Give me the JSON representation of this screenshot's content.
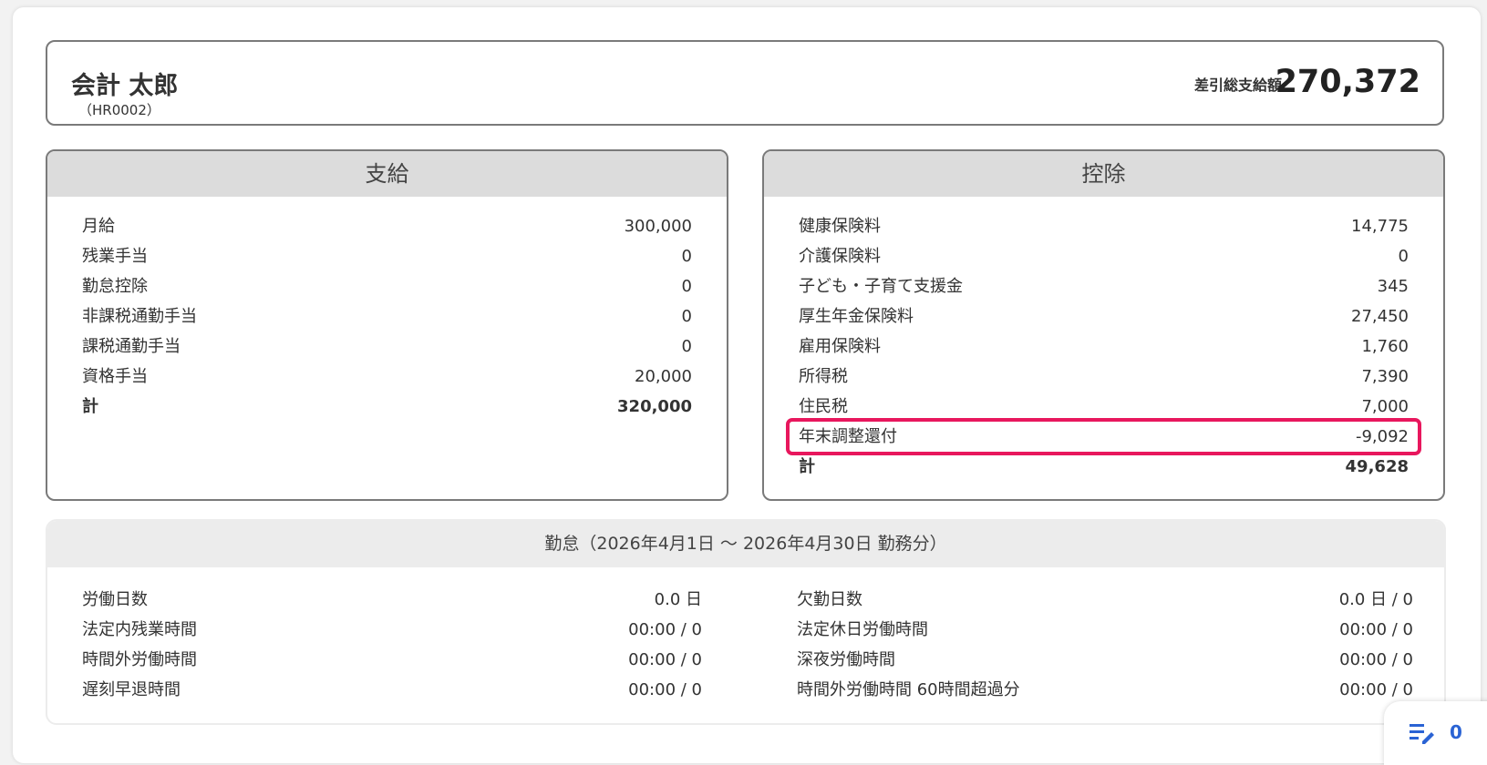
{
  "employee": {
    "name": "会計 太郎",
    "code": "（HR0002）",
    "net_label": "差引総支給額",
    "net_value": "270,372"
  },
  "payments": {
    "title": "支給",
    "items": [
      {
        "label": "月給",
        "value": "300,000"
      },
      {
        "label": "残業手当",
        "value": "0"
      },
      {
        "label": "勤怠控除",
        "value": "0"
      },
      {
        "label": "非課税通勤手当",
        "value": "0"
      },
      {
        "label": "課税通勤手当",
        "value": "0"
      },
      {
        "label": "資格手当",
        "value": "20,000"
      }
    ],
    "total_label": "計",
    "total_value": "320,000"
  },
  "deductions": {
    "title": "控除",
    "items": [
      {
        "label": "健康保険料",
        "value": "14,775"
      },
      {
        "label": "介護保険料",
        "value": "0"
      },
      {
        "label": "子ども・子育て支援金",
        "value": "345"
      },
      {
        "label": "厚生年金保険料",
        "value": "27,450"
      },
      {
        "label": "雇用保険料",
        "value": "1,760"
      },
      {
        "label": "所得税",
        "value": "7,390"
      },
      {
        "label": "住民税",
        "value": "7,000"
      },
      {
        "label": "年末調整還付",
        "value": "-9,092"
      }
    ],
    "total_label": "計",
    "total_value": "49,628",
    "highlight_color": "#e8175d"
  },
  "attendance": {
    "title": "勤怠（2026年4月1日 〜 2026年4月30日 勤務分）",
    "left": [
      {
        "label": "労働日数",
        "value": "0.0 日"
      },
      {
        "label": "法定内残業時間",
        "value": "00:00 / 0"
      },
      {
        "label": "時間外労働時間",
        "value": "00:00 / 0"
      },
      {
        "label": "遅刻早退時間",
        "value": "00:00 / 0"
      }
    ],
    "right": [
      {
        "label": "欠勤日数",
        "value": "0.0 日 / 0"
      },
      {
        "label": "法定休日労働時間",
        "value": "00:00 / 0"
      },
      {
        "label": "深夜労働時間",
        "value": "00:00 / 0"
      },
      {
        "label": "時間外労働時間 60時間超過分",
        "value": "00:00 / 0"
      }
    ]
  },
  "fab": {
    "icon": "edit-list-icon",
    "count": "0",
    "accent": "#2a63d4"
  }
}
